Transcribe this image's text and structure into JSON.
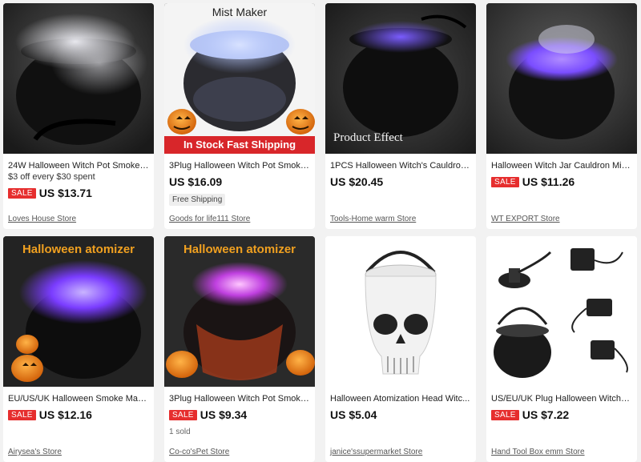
{
  "products": [
    {
      "title": "24W Halloween Witch Pot Smoke ...",
      "promo": "$3 off every $30 spent",
      "sale": "SALE",
      "price": "US $13.71",
      "store": "Loves House Store"
    },
    {
      "title": "3Plug Halloween Witch Pot Smoke ...",
      "price": "US $16.09",
      "badge": "Free Shipping",
      "store": "Goods for life111 Store",
      "image_top_text": "Mist Maker",
      "image_banner_text": "In Stock Fast Shipping"
    },
    {
      "title": "1PCS Halloween Witch's Cauldron ...",
      "price": "US $20.45",
      "store": "Tools-Home warm Store",
      "image_caption": "Product Effect"
    },
    {
      "title": "Halloween Witch Jar Cauldron Mist...",
      "sale": "SALE",
      "price": "US $11.26",
      "store": "WT EXPORT Store"
    },
    {
      "title": "EU/US/UK Halloween Smoke Mach...",
      "sale": "SALE",
      "price": "US $12.16",
      "store": "Airysea's Store",
      "image_top_text": "Halloween atomizer"
    },
    {
      "title": "3Plug Halloween Witch Pot Smoke ...",
      "sale": "SALE",
      "price": "US $9.34",
      "sold": "1 sold",
      "store": "Co-co'sPet Store",
      "image_top_text": "Halloween atomizer"
    },
    {
      "title": "Halloween Atomization Head Witc...",
      "price": "US $5.04",
      "store": "janice'ssupermarket Store"
    },
    {
      "title": "US/EU/UK Plug Halloween Witch Ja...",
      "sale": "SALE",
      "price": "US $7.22",
      "store": "Hand Tool Box emm Store"
    }
  ],
  "colors": {
    "sale_badge": "#e62e2e",
    "banner_red": "#d8262a",
    "mist_purple": "#8a5cff",
    "mist_blue": "#9fb6ff",
    "orange_text": "#f0a020"
  }
}
